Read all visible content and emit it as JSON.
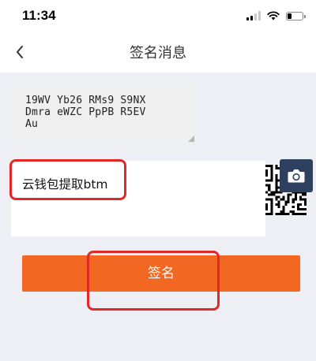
{
  "status_bar": {
    "time": "11:34"
  },
  "nav": {
    "title": "签名消息",
    "back_icon": "chevron-left-icon"
  },
  "address": {
    "text": "19WV Yb26 RMs9 S9NX\nDmra eWZC PpPB R5EV\nAu"
  },
  "message": {
    "value": "云钱包提取btm"
  },
  "camera": {
    "icon": "camera-icon"
  },
  "sign_button": {
    "label": "签名"
  },
  "colors": {
    "accent_button": "#f26722",
    "camera_button": "#2e4060",
    "highlight": "#e32727",
    "page_background": "#eeeef5"
  }
}
